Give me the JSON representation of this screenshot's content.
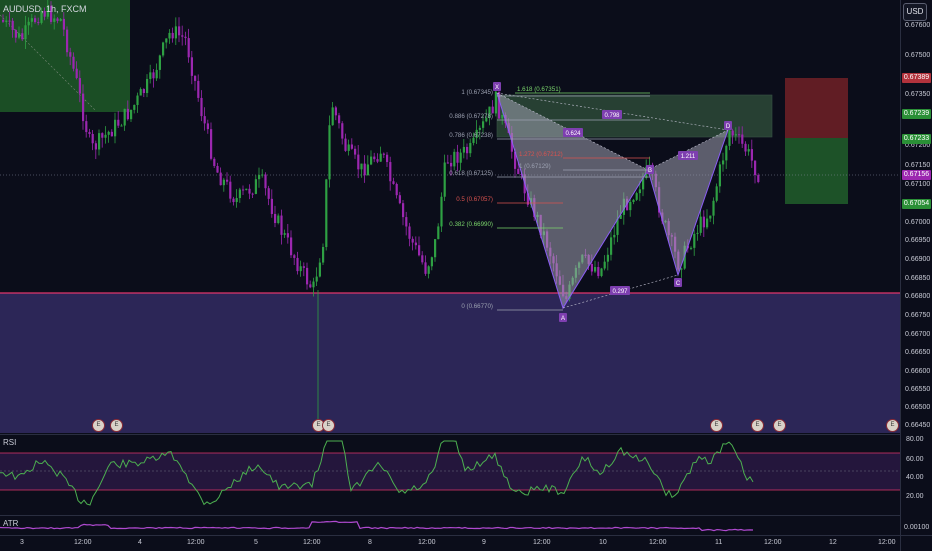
{
  "symbol": "AUDUSD, 1h, FXCM",
  "currency": "USD",
  "price_axis": [
    "0.67600",
    "0.67500",
    "0.67400",
    "0.67350",
    "0.67300",
    "0.67250",
    "0.67200",
    "0.67150",
    "0.67100",
    "0.67050",
    "0.67000",
    "0.66950",
    "0.66900",
    "0.66850",
    "0.66800",
    "0.66750",
    "0.66700",
    "0.66650",
    "0.66600",
    "0.66550",
    "0.66500",
    "0.66450"
  ],
  "price_tags": [
    {
      "label": "0.67389",
      "color": "#b2323c"
    },
    {
      "label": "0.67239",
      "color": "#2a8f36"
    },
    {
      "label": "0.67233",
      "color": "#2a8f36"
    },
    {
      "label": "0.67156",
      "color": "#9c27b0"
    },
    {
      "label": "0.67054",
      "color": "#2a8f36"
    }
  ],
  "time_axis": [
    "3",
    "12:00",
    "4",
    "12:00",
    "5",
    "12:00",
    "8",
    "12:00",
    "9",
    "12:00",
    "10",
    "12:00",
    "11",
    "12:00",
    "12",
    "12:00"
  ],
  "fib_levels": [
    {
      "label": "1.618 (0.67351)",
      "color": "#7bd66c"
    },
    {
      "label": "1 (0.67345)",
      "color": "#9ba0b0"
    },
    {
      "label": "0.886 (0.67278)",
      "color": "#9ba0b0"
    },
    {
      "label": "0.786 (0.67238)",
      "color": "#9ba0b0"
    },
    {
      "label": "1.272 (0.67212)",
      "color": "#d9534f"
    },
    {
      "label": "1 (0.67129)",
      "color": "#9ba0b0"
    },
    {
      "label": "0.618 (0.67125)",
      "color": "#9ba0b0"
    },
    {
      "label": "0.5 (0.67057)",
      "color": "#d9534f"
    },
    {
      "label": "0.382 (0.66990)",
      "color": "#7bd66c"
    },
    {
      "label": "0 (0.66770)",
      "color": "#9ba0b0"
    }
  ],
  "pattern_points": [
    "X",
    "A",
    "B",
    "C",
    "D"
  ],
  "pattern_ratios": [
    "0.624",
    "0.798",
    "1.211",
    "0.297"
  ],
  "rsi": {
    "label": "RSI",
    "axis": [
      "80.00",
      "60.00",
      "40.00",
      "20.00"
    ]
  },
  "atr": {
    "label": "ATR",
    "axis": [
      "0.00100"
    ]
  },
  "colors": {
    "bull": "#2ea043",
    "bear": "#9c27b0",
    "support": "#e0356b",
    "zone": "#322c63"
  }
}
